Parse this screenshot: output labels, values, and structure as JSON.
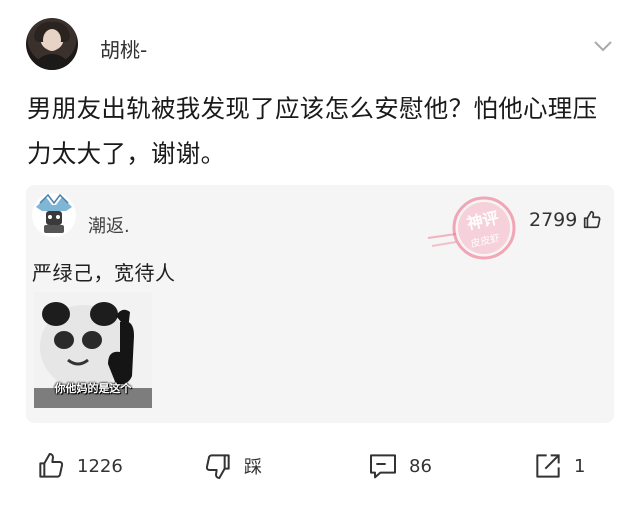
{
  "post": {
    "username": "胡桃-",
    "text": "男朋友出轨被我发现了应该怎么安慰他？怕他心理压力太大了，谢谢。"
  },
  "comment": {
    "username": "潮返.",
    "like_count": "2799",
    "text": "严绿己，宽待人",
    "image_caption": "你他妈的是这个",
    "watermark": {
      "line1": "神评",
      "line2": "皮皮虾"
    }
  },
  "actions": {
    "like_count": "1226",
    "dislike_label": "踩",
    "comment_count": "86",
    "share_count": "1"
  },
  "colors": {
    "watermark": "#f05a78",
    "icon": "#333333"
  }
}
